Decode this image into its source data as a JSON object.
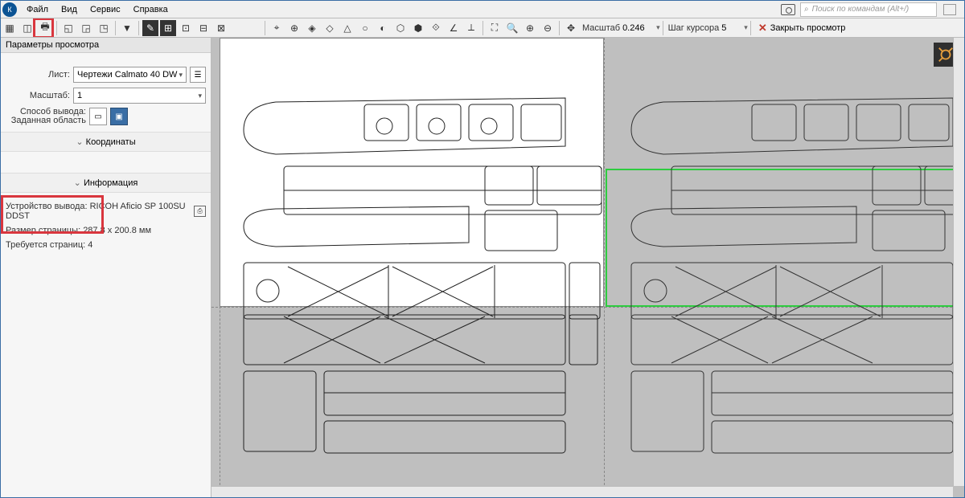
{
  "menu": {
    "file": "Файл",
    "view": "Вид",
    "service": "Сервис",
    "help": "Справка"
  },
  "search_placeholder": "Поиск по командам (Alt+/)",
  "toolbar": {
    "scale_label": "Масштаб",
    "scale_value": "0.246",
    "cursor_step_label": "Шаг курсора",
    "cursor_step_value": "5",
    "close_preview": "Закрыть просмотр"
  },
  "panel": {
    "title": "Параметры просмотра",
    "sheet_label": "Лист:",
    "sheet_value": "Чертежи Calmato 40 DW",
    "scale_label": "Масштаб:",
    "scale_value": "1",
    "output_method_l1": "Способ вывода:",
    "output_method_l2": "Заданная область",
    "coords_section": "Координаты",
    "info_section": "Информация",
    "device_label": "Устройство вывода:",
    "device_value": "RICOH Aficio SP 100SU DDST",
    "page_size_label": "Размер страницы:",
    "page_size_value": "287.8 x 200.8 мм",
    "pages_needed_label": "Требуется страниц:",
    "pages_needed_value": "4"
  },
  "colors": {
    "accent": "#3a6ea5",
    "green": "#2ecc40",
    "highlight": "#d9363e"
  }
}
